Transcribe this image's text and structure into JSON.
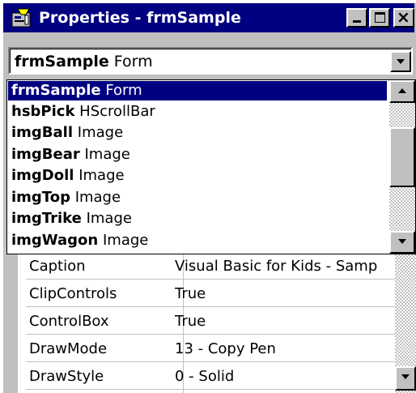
{
  "window": {
    "title": "Properties - frmSample",
    "title_icon": "properties-icon",
    "controls": {
      "minimize": "minimize-icon",
      "maximize": "maximize-icon",
      "close": "×"
    }
  },
  "object_combo": {
    "name": "frmSample",
    "type": "Form"
  },
  "dropdown": {
    "items": [
      {
        "name": "frmSample",
        "type": "Form",
        "selected": true
      },
      {
        "name": "hsbPick",
        "type": "HScrollBar",
        "selected": false
      },
      {
        "name": "imgBall",
        "type": "Image",
        "selected": false
      },
      {
        "name": "imgBear",
        "type": "Image",
        "selected": false
      },
      {
        "name": "imgDoll",
        "type": "Image",
        "selected": false
      },
      {
        "name": "imgTop",
        "type": "Image",
        "selected": false
      },
      {
        "name": "imgTrike",
        "type": "Image",
        "selected": false
      },
      {
        "name": "imgWagon",
        "type": "Image",
        "selected": false
      }
    ]
  },
  "properties": [
    {
      "name": "Caption",
      "value": "Visual Basic for Kids - Samp"
    },
    {
      "name": "ClipControls",
      "value": "True"
    },
    {
      "name": "ControlBox",
      "value": "True"
    },
    {
      "name": "DrawMode",
      "value": "13 - Copy Pen"
    },
    {
      "name": "DrawStyle",
      "value": "0 - Solid"
    }
  ],
  "colors": {
    "title_bar": "#000080",
    "selection": "#000080",
    "face": "#c0c0c0"
  }
}
